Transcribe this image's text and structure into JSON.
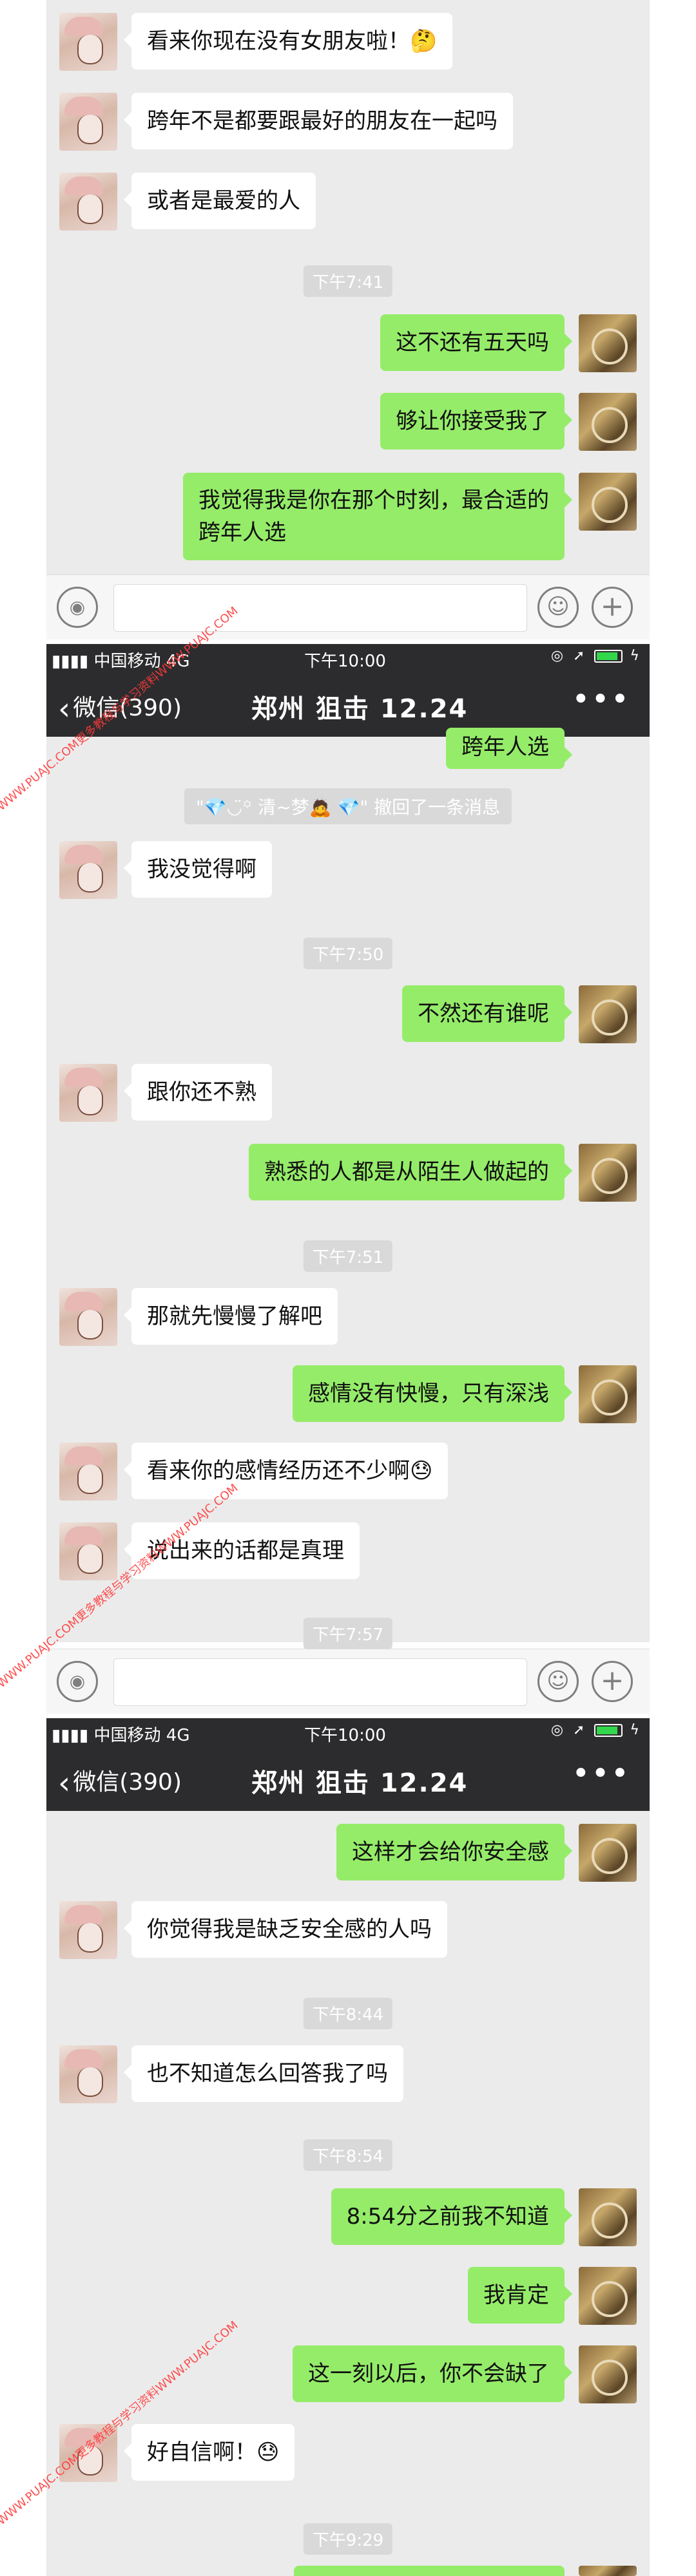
{
  "status": {
    "carrier": "中国移动",
    "network": "4G",
    "time": "下午10:00"
  },
  "nav": {
    "back": "微信(390)",
    "title": "郑州 狙击 12.24"
  },
  "timestamps": [
    "下午7:41",
    "下午7:50",
    "下午7:51",
    "下午7:57",
    "下午8:44",
    "下午8:54",
    "下午9:29"
  ],
  "recall": "\"💎◡̈꙳ 清~梦🙇 💎\" 撤回了一条消息",
  "messages": {
    "m1": "看来你现在没有女朋友啦！🤔",
    "m2": "跨年不是都要跟最好的朋友在一起吗",
    "m3": "或者是最爱的人",
    "m4": "这不还有五天吗",
    "m5": "够让你接受我了",
    "m6a": "我觉得我是你在那个时刻，最合适的",
    "m6b": "跨年人选",
    "m7": "跨年人选",
    "m8": "我没觉得啊",
    "m9": "不然还有谁呢",
    "m10": "跟你还不熟",
    "m11": "熟悉的人都是从陌生人做起的",
    "m12": "那就先慢慢了解吧",
    "m13": "感情没有快慢，只有深浅",
    "m14": "看来你的感情经历还不少啊😓",
    "m15": "说出来的话都是真理",
    "m16": "这样才会给你安全感",
    "m17": "你觉得我是缺乏安全感的人吗",
    "m18": "也不知道怎么回答我了吗",
    "m19": "8:54分之前我不知道",
    "m20": "我肯定",
    "m21": "这一刻以后，你不会缺了",
    "m22": "好自信啊！😓"
  },
  "watermark": "WWW.PUAJC.COM更多教程与学习资料WWW.PUAJC.COM",
  "icons": {
    "back": "chevron-left-icon",
    "more": "more-dots-icon",
    "voice": "voice-icon",
    "emoji": "emoji-icon",
    "plus": "plus-icon"
  },
  "colors": {
    "chat_bg": "#ebebeb",
    "out_bubble": "#95ec69",
    "in_bubble": "#ffffff",
    "navbar": "#2c2c2e"
  }
}
